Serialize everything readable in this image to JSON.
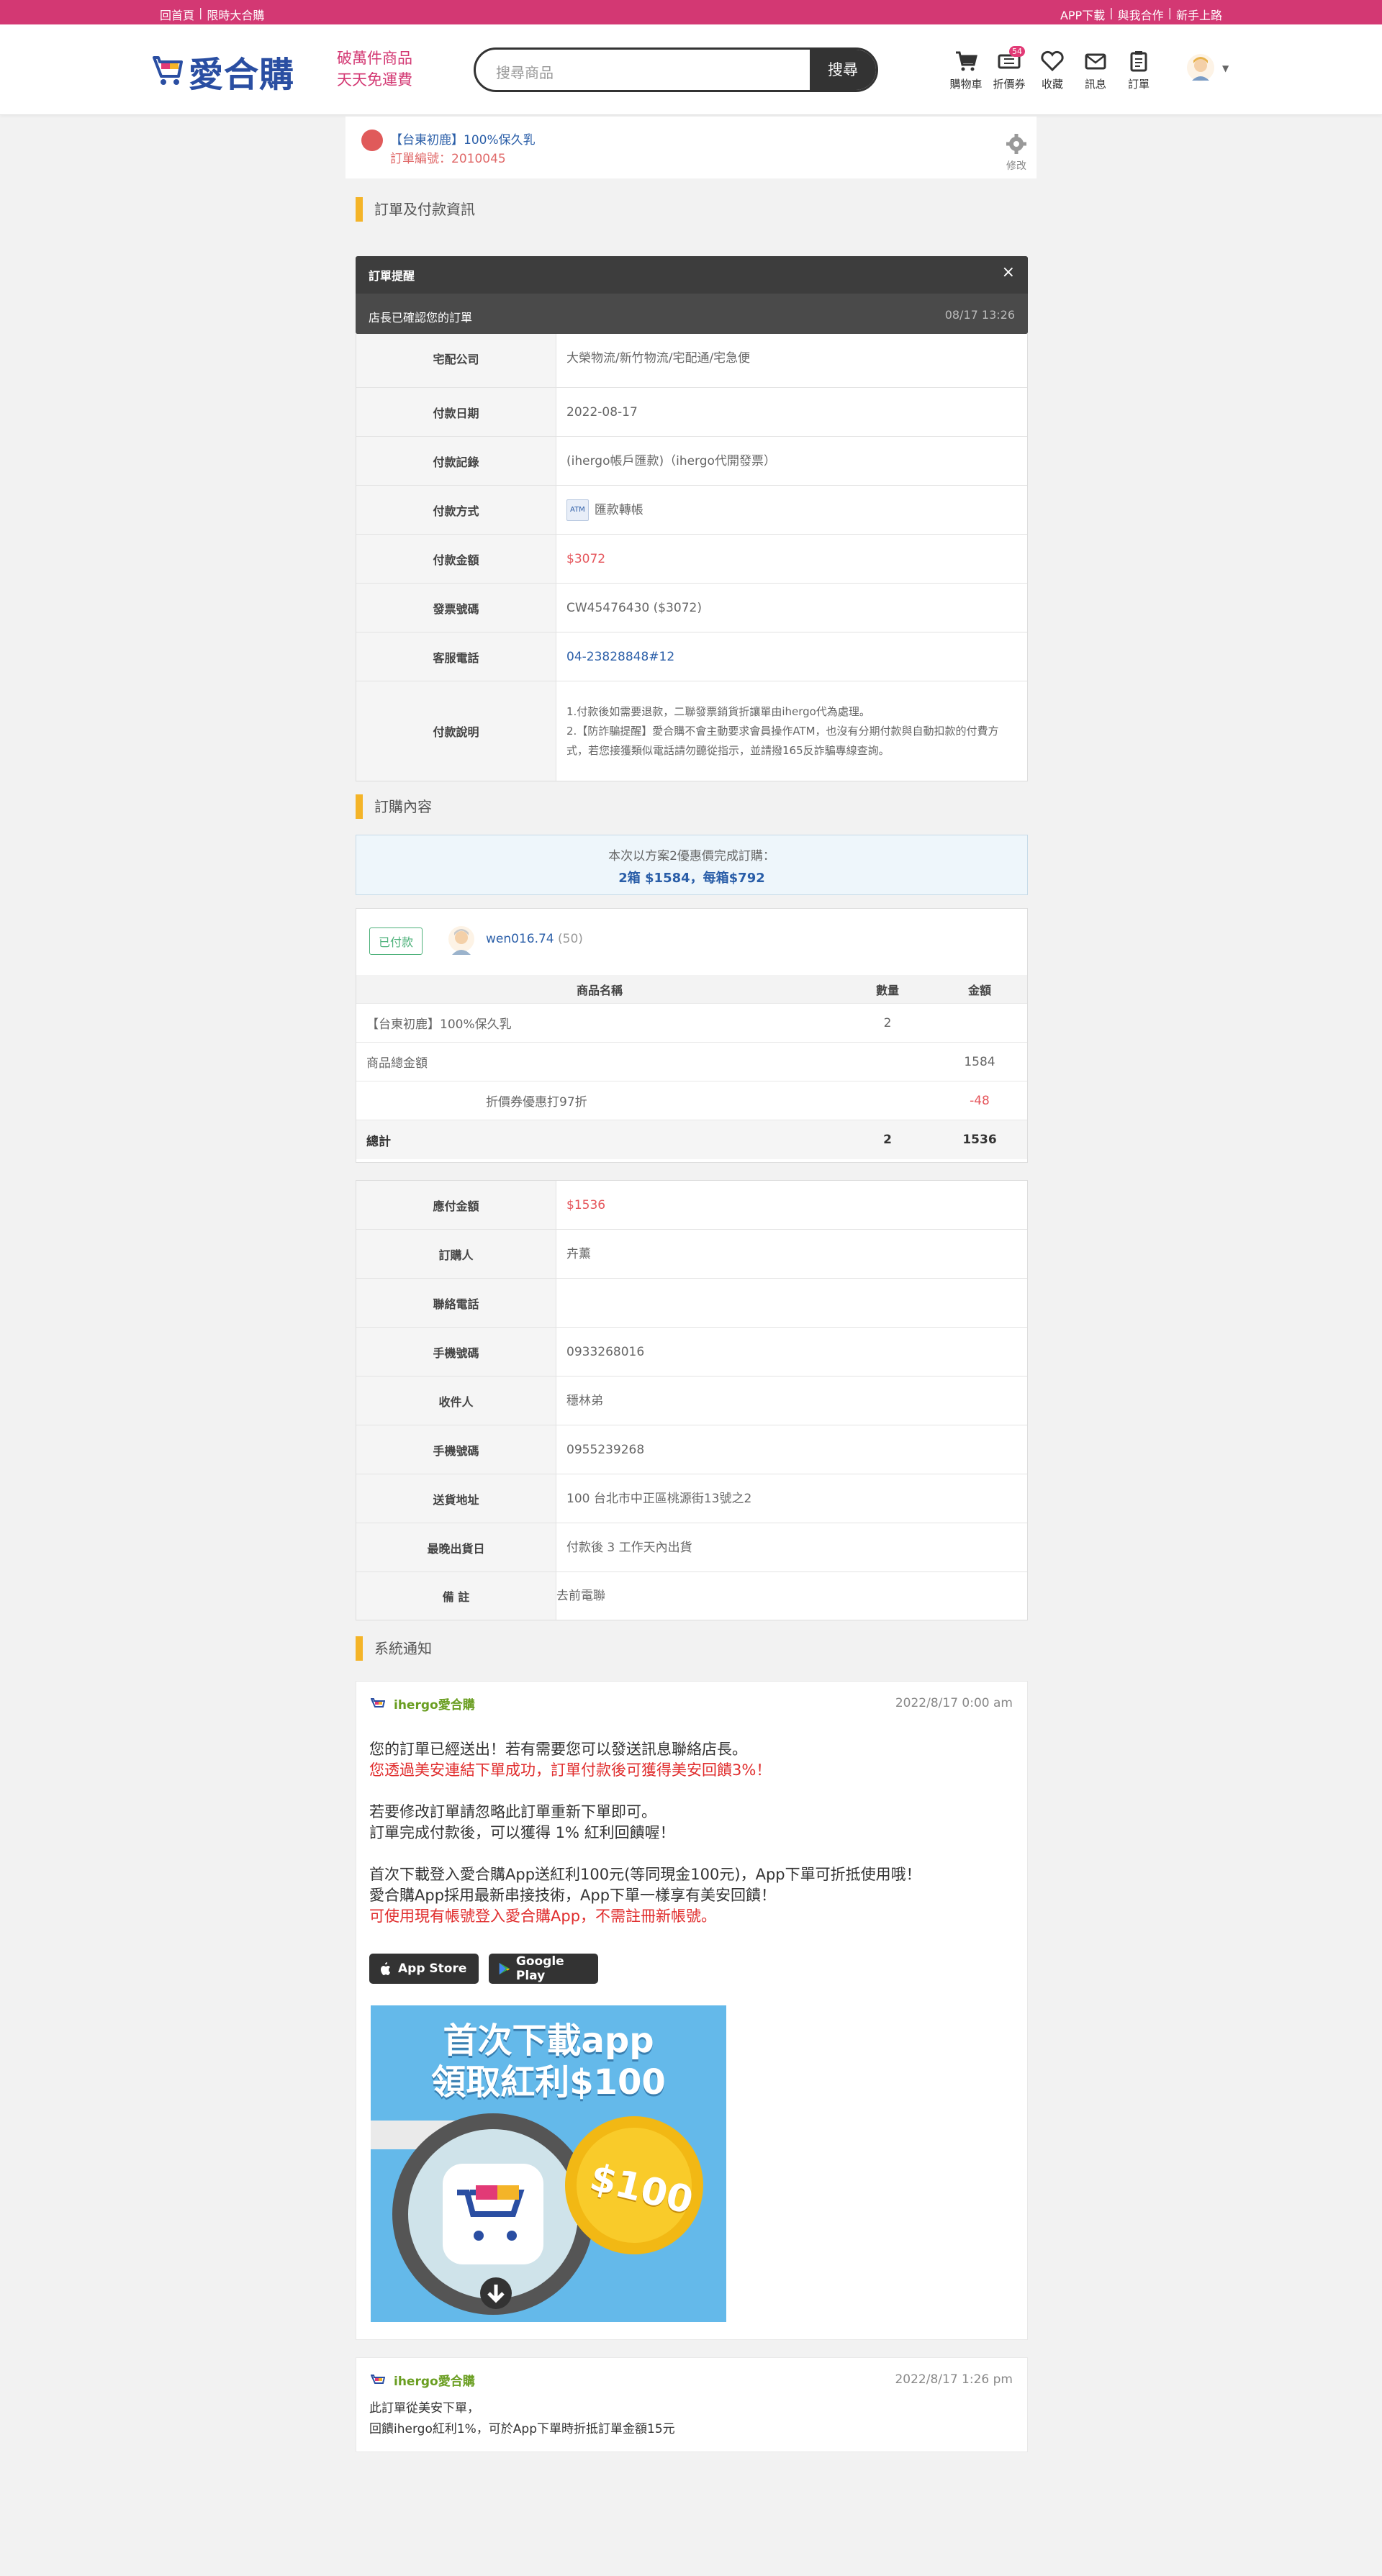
{
  "topbar": {
    "home": "回首頁",
    "group_buy": "限時大合購",
    "app_download": "APP下載",
    "partner": "與我合作",
    "newbie": "新手上路"
  },
  "brand": {
    "name": "愛合購",
    "slogan_1": "破萬件商品",
    "slogan_2": "天天免運費",
    "color": "#d33873"
  },
  "search": {
    "placeholder": "搜尋商品",
    "button": "搜尋"
  },
  "nav": {
    "cart": "購物車",
    "coupon": "折價券",
    "coupon_badge": "54",
    "favorite": "收藏",
    "message": "訊息",
    "order": "訂單"
  },
  "product": {
    "name": "【台東初鹿】100%保久乳",
    "order_no": "訂單編號：2010045",
    "edit": "修改"
  },
  "sections": {
    "payment": "訂單及付款資訊",
    "contents": "訂購內容",
    "system": "系統通知"
  },
  "toast": {
    "title": "訂單提醒",
    "close": "×",
    "message": "店長已確認您的訂單",
    "time": "08/17 13:26"
  },
  "payment_info": {
    "courier_label": "宅配公司",
    "courier": "大榮物流/新竹物流/宅配通/宅急便",
    "pay_date_label": "付款日期",
    "pay_date": "2022-08-17",
    "pay_record_label": "付款記錄",
    "pay_record": "(ihergo帳戶匯款)（ihergo代開發票）",
    "pay_method_label": "付款方式",
    "pay_method_icon": "ATM",
    "pay_method": "匯款轉帳",
    "amount_label": "付款金額",
    "amount": "$3072",
    "invoice_label": "發票號碼",
    "invoice": "CW45476430 ($3072)",
    "service_label": "客服電話",
    "service_phone": "04-23828848#12",
    "note_label": "付款說明",
    "note_1": "1.付款後如需要退款，二聯發票銷貨折讓單由ihergo代為處理。",
    "note_2": "2.【防詐騙提醒】愛合購不會主動要求會員操作ATM，也沒有分期付款與自動扣款的付費方式，若您接獲類似電話請勿聽從指示，並請撥165反詐騙專線查詢。"
  },
  "promo": {
    "line1": "本次以方案2優惠價完成訂購：",
    "line2": "2箱 $1584，每箱$792"
  },
  "order": {
    "status": "已付款",
    "buyer": "wen016.74",
    "buyer_count": "(50)",
    "col_name": "商品名稱",
    "col_qty": "數量",
    "col_amount": "金額",
    "items": [
      {
        "name": "【台東初鹿】100%保久乳",
        "qty": "2",
        "amount": ""
      }
    ],
    "subtotal_label": "商品總金額",
    "subtotal": "1584",
    "discount_label": "折價券優惠打97折",
    "discount": "-48",
    "total_label": "總計",
    "total_qty": "2",
    "total": "1536"
  },
  "buyer_info": {
    "due_label": "應付金額",
    "due": "$1536",
    "orderer_label": "訂購人",
    "orderer": "卉薰",
    "contact_label": "聯絡電話",
    "contact": "",
    "mobile_label": "手機號碼",
    "mobile": "0933268016",
    "receiver_label": "收件人",
    "receiver": "穩林弟",
    "mobile2_label": "手機號碼",
    "mobile2": "0955239268",
    "address_label": "送貨地址",
    "address": "100 台北市中正區桃源街13號之2",
    "ship_label": "最晚出貨日",
    "ship": "付款後 3 工作天內出貨",
    "remark_label": "備 註",
    "remark": "去前電聯"
  },
  "notifications": [
    {
      "sender": "ihergo愛合購",
      "time": "2022/8/17  0:00 am",
      "l1": "您的訂單已經送出！若有需要您可以發送訊息聯絡店長。",
      "l2": "您透過美安連結下單成功，訂單付款後可獲得美安回饋3%！",
      "l3": "若要修改訂單請忽略此訂單重新下單即可。",
      "l4": "訂單完成付款後，可以獲得 1% 紅利回饋喔！",
      "l5": "首次下載登入愛合購App送紅利100元(等同現金100元)，App下單可折抵使用哦！",
      "l6": "愛合購App採用最新串接技術，App下單一樣享有美安回饋！",
      "l7": "可使用現有帳號登入愛合購App，不需註冊新帳號。",
      "appstore": "App Store",
      "googleplay": "Google Play",
      "banner_1": "首次下載app",
      "banner_2": "領取紅利$100",
      "banner_coin": "$100"
    },
    {
      "sender": "ihergo愛合購",
      "time": "2022/8/17  1:26 pm",
      "l1": "此訂單從美安下單，",
      "l2": "回饋ihergo紅利1%，可於App下單時折抵訂單金額15元"
    }
  ]
}
